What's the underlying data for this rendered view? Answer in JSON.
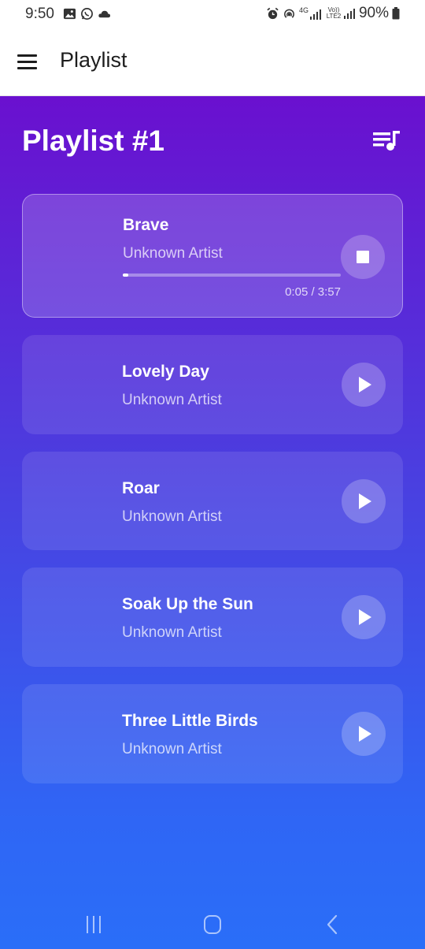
{
  "status_bar": {
    "time": "9:50",
    "left_icons": [
      "image-icon",
      "whatsapp-icon",
      "cloud-icon"
    ],
    "right_icons": [
      "alarm-icon",
      "hotspot-icon",
      "4g-signal-icon",
      "volte-signal-icon"
    ],
    "network_label": "4G",
    "volte_label": "Vo)) LTE2",
    "battery": "90%"
  },
  "app_bar": {
    "title": "Playlist",
    "menu_icon": "menu-icon"
  },
  "playlist": {
    "name": "Playlist #1",
    "queue_icon": "queue-music-icon",
    "tracks": [
      {
        "title": "Brave",
        "artist": "Unknown Artist",
        "state": "playing",
        "control_icon": "stop-icon",
        "elapsed": "0:05",
        "duration": "3:57",
        "time_text": "0:05 / 3:57",
        "progress": 0.021
      },
      {
        "title": "Lovely Day",
        "artist": "Unknown Artist",
        "state": "stopped",
        "control_icon": "play-icon"
      },
      {
        "title": "Roar",
        "artist": "Unknown Artist",
        "state": "stopped",
        "control_icon": "play-icon"
      },
      {
        "title": "Soak Up the Sun",
        "artist": "Unknown Artist",
        "state": "stopped",
        "control_icon": "play-icon"
      },
      {
        "title": "Three Little Birds",
        "artist": "Unknown Artist",
        "state": "stopped",
        "control_icon": "play-icon"
      }
    ]
  },
  "nav_bar": {
    "buttons": [
      "recent-apps-icon",
      "home-icon",
      "back-icon"
    ]
  },
  "colors": {
    "gradient_top": "#6a10cf",
    "gradient_mid": "#4a3fe0",
    "gradient_bottom": "#2a6ef8",
    "text_primary": "#ffffff"
  }
}
